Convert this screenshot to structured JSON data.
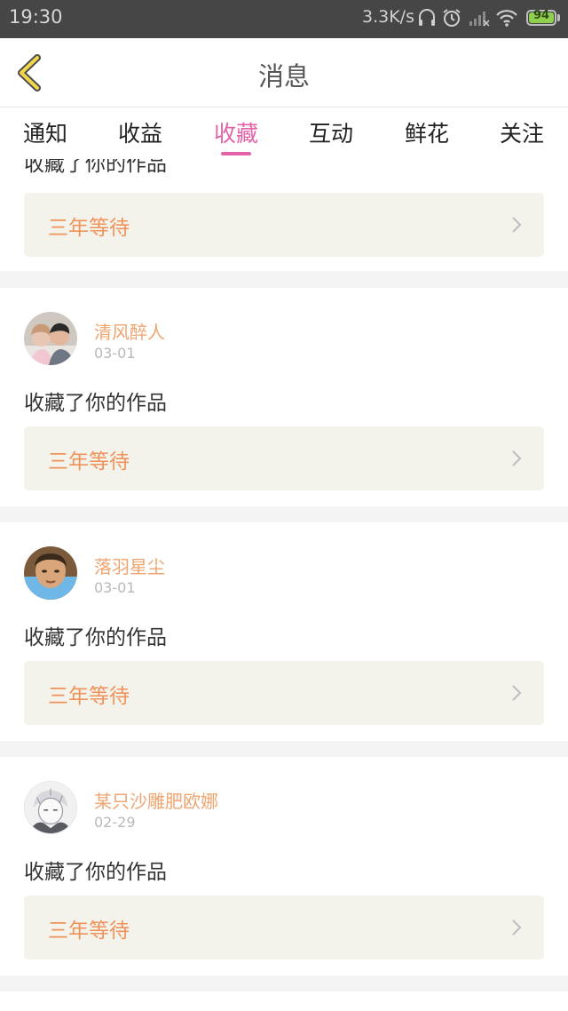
{
  "status_bar": {
    "time": "19:30",
    "net_speed": "3.3K/s",
    "battery": "94",
    "icons": [
      "headset-icon",
      "alarm-icon",
      "signal-icon",
      "wifi-icon",
      "battery-icon"
    ]
  },
  "header": {
    "back_icon": "chevron-left-icon",
    "title": "消息"
  },
  "tabs": [
    {
      "label": "通知"
    },
    {
      "label": "收益"
    },
    {
      "label": "收藏"
    },
    {
      "label": "互动"
    },
    {
      "label": "鲜花"
    },
    {
      "label": "关注"
    }
  ],
  "active_tab": "收藏",
  "partial_item": {
    "action": "收藏了你的作品",
    "work_title": "三年等待"
  },
  "items": [
    {
      "username": "清风醉人",
      "date": "03-01",
      "action": "收藏了你的作品",
      "work_title": "三年等待"
    },
    {
      "username": "落羽星尘",
      "date": "03-01",
      "action": "收藏了你的作品",
      "work_title": "三年等待"
    },
    {
      "username": "某只沙雕肥欧娜",
      "date": "02-29",
      "action": "收藏了你的作品",
      "work_title": "三年等待"
    }
  ],
  "colors": {
    "accent_pink": "#e462a8",
    "username_orange": "#f0a470",
    "work_title_orange": "#f0935a",
    "status_bar_bg": "#464646",
    "work_link_bg": "#f3f3ec"
  }
}
